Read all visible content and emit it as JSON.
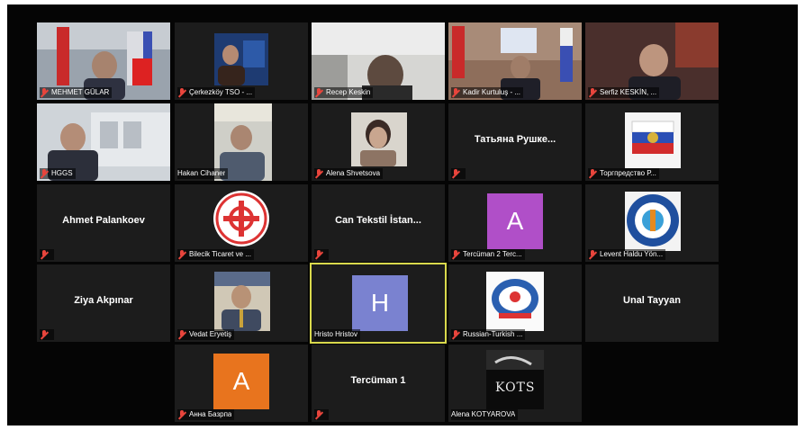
{
  "meeting": {
    "participants": [
      {
        "id": "p1",
        "label": "MEHMET GÜLAR"
      },
      {
        "id": "p2",
        "label": "Çerkezköy TSO - ..."
      },
      {
        "id": "p3",
        "label": "Recep Keskin"
      },
      {
        "id": "p4",
        "label": "Kadir Kurtuluş - ..."
      },
      {
        "id": "p5",
        "label": "Serfiz KESKİN, ..."
      },
      {
        "id": "p6",
        "label": "HGGS"
      },
      {
        "id": "p7",
        "label": "Hakan Cihaner"
      },
      {
        "id": "p8",
        "label": "Alena Shvetsova"
      },
      {
        "id": "p9",
        "center": "Татьяна Рушке..."
      },
      {
        "id": "p10",
        "label": "Торгпредство Р..."
      },
      {
        "id": "p11",
        "center": "Ahmet Palankoev"
      },
      {
        "id": "p12",
        "label": "Bilecik Ticaret ve ..."
      },
      {
        "id": "p13",
        "center": "Can Tekstil İstan..."
      },
      {
        "id": "p14",
        "label": "Tercüman 2 Terc...",
        "avatar": "A",
        "color": "#b04fc8"
      },
      {
        "id": "p15",
        "label": "Levent Haldu Yön..."
      },
      {
        "id": "p16",
        "center": "Ziya Akpınar"
      },
      {
        "id": "p17",
        "label": "Vedat Eryetiş"
      },
      {
        "id": "p18",
        "label": "Hristo Hristov",
        "avatar": "H",
        "color": "#7a82d0"
      },
      {
        "id": "p19",
        "label": "Russian-Turkish ..."
      },
      {
        "id": "p20",
        "center": "Unal Tayyan"
      },
      {
        "id": "p21",
        "label": "Анна Базрпа",
        "avatar": "A",
        "color": "#e8741e"
      },
      {
        "id": "p22",
        "center": "Tercüman 1"
      },
      {
        "id": "p23",
        "label": "Alena KOTYAROVA",
        "logo_text": "KOTS"
      }
    ]
  }
}
